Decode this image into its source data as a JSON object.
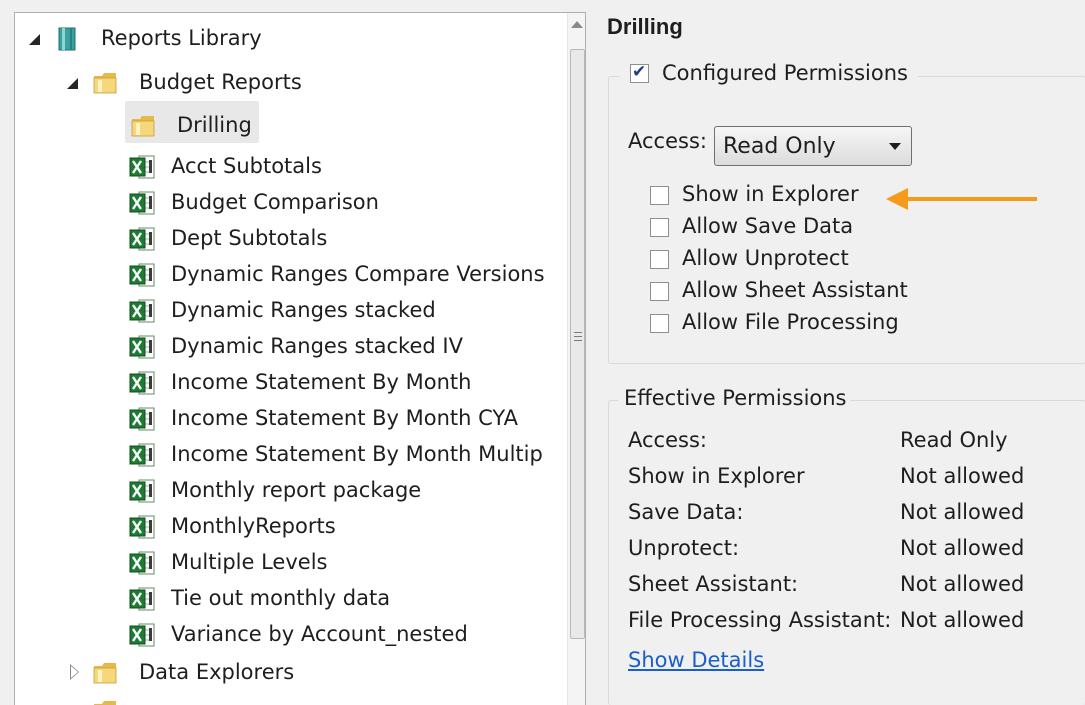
{
  "tree": {
    "root_label": "Reports Library",
    "budget_folder_label": "Budget Reports",
    "drilling_label": "Drilling",
    "reports": [
      "Acct Subtotals",
      "Budget Comparison",
      "Dept Subtotals",
      "Dynamic Ranges Compare Versions",
      "Dynamic Ranges stacked",
      "Dynamic Ranges stacked IV",
      "Income Statement By Month",
      "Income Statement By Month CYA",
      "Income Statement By Month Multip",
      "Monthly report package",
      "MonthlyReports",
      "Multiple Levels",
      "Tie out monthly data",
      "Variance by Account_nested"
    ],
    "data_explorers_label": "Data Explorers"
  },
  "details": {
    "title": "Drilling",
    "configured": {
      "label": "Configured Permissions",
      "checked": true,
      "access_label": "Access:",
      "access_value": "Read Only",
      "options": [
        {
          "label": "Show in Explorer",
          "checked": false
        },
        {
          "label": "Allow Save Data",
          "checked": false
        },
        {
          "label": "Allow Unprotect",
          "checked": false
        },
        {
          "label": "Allow Sheet Assistant",
          "checked": false
        },
        {
          "label": "Allow File Processing",
          "checked": false
        }
      ]
    },
    "effective": {
      "label": "Effective Permissions",
      "rows": [
        {
          "key": "Access:",
          "value": "Read Only"
        },
        {
          "key": "Show in Explorer",
          "value": "Not allowed"
        },
        {
          "key": "Save Data:",
          "value": "Not allowed"
        },
        {
          "key": "Unprotect:",
          "value": "Not allowed"
        },
        {
          "key": "Sheet Assistant:",
          "value": "Not allowed"
        },
        {
          "key": "File Processing Assistant:",
          "value": "Not allowed"
        }
      ],
      "show_details_link": "Show Details"
    }
  },
  "colors": {
    "annotation_arrow": "#f59a1b",
    "link": "#1a5ec9"
  }
}
